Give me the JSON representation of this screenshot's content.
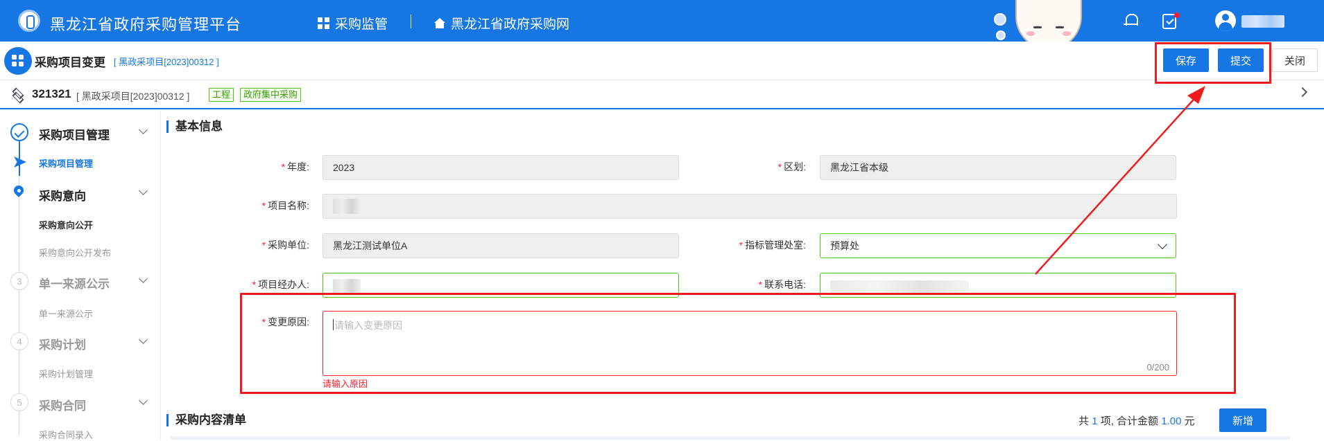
{
  "topbar": {
    "app_title": "黑龙江省政府采购管理平台",
    "nav": [
      {
        "label": "采购监管",
        "icon": "grid-icon"
      },
      {
        "label": "黑龙江省政府采购网",
        "icon": "home-icon"
      }
    ],
    "icons": [
      "bell-icon",
      "task-icon",
      "avatar-icon"
    ]
  },
  "pagebar": {
    "title": "采购项目变更",
    "code": "[ 黑政采项目[2023]00312 ]",
    "buttons": {
      "save": "保存",
      "submit": "提交",
      "close": "关闭"
    }
  },
  "infobar": {
    "project_id": "321321",
    "project_code": "[ 黑政采项目[2023]00312 ]",
    "tags": [
      "工程",
      "政府集中采购"
    ]
  },
  "sidebar": {
    "steps": [
      {
        "label": "采购项目管理",
        "status": "done",
        "subs": [
          {
            "label": "采购项目管理",
            "active": true
          }
        ]
      },
      {
        "label": "采购意向",
        "status": "current",
        "subs": [
          {
            "label": "采购意向公开"
          },
          {
            "label": "采购意向公开发布"
          }
        ]
      },
      {
        "label": "单一来源公示",
        "number": "3",
        "subs": [
          {
            "label": "单一来源公示"
          }
        ]
      },
      {
        "label": "采购计划",
        "number": "4",
        "subs": [
          {
            "label": "采购计划管理"
          }
        ]
      },
      {
        "label": "采购合同",
        "number": "5",
        "subs": [
          {
            "label": "采购合同录入"
          }
        ]
      }
    ]
  },
  "form": {
    "section_title": "基本信息",
    "year_label": "年度:",
    "year_value": "2023",
    "region_label": "区划:",
    "region_value": "黑龙江省本级",
    "project_name_label": "项目名称:",
    "unit_label": "采购单位:",
    "unit_value": "黑龙江测试单位A",
    "dept_label": "指标管理处室:",
    "dept_value": "预算处",
    "manager_label": "项目经办人:",
    "phone_label": "联系电话:",
    "reason_label": "变更原因:",
    "reason_placeholder": "请输入变更原因",
    "reason_count": "0/200",
    "reason_error": "请输入原因",
    "required_mark": "*"
  },
  "list": {
    "section_title": "采购内容清单",
    "summary_prefix": "共",
    "summary_count": "1",
    "summary_mid": "项,  合计金额",
    "summary_amount": "1.00",
    "summary_suffix": "元",
    "add_button": "新增"
  },
  "colors": {
    "brand": "#1677e4",
    "annotation": "#ee1c1c",
    "success": "#52c41a",
    "error": "#f5222d"
  }
}
